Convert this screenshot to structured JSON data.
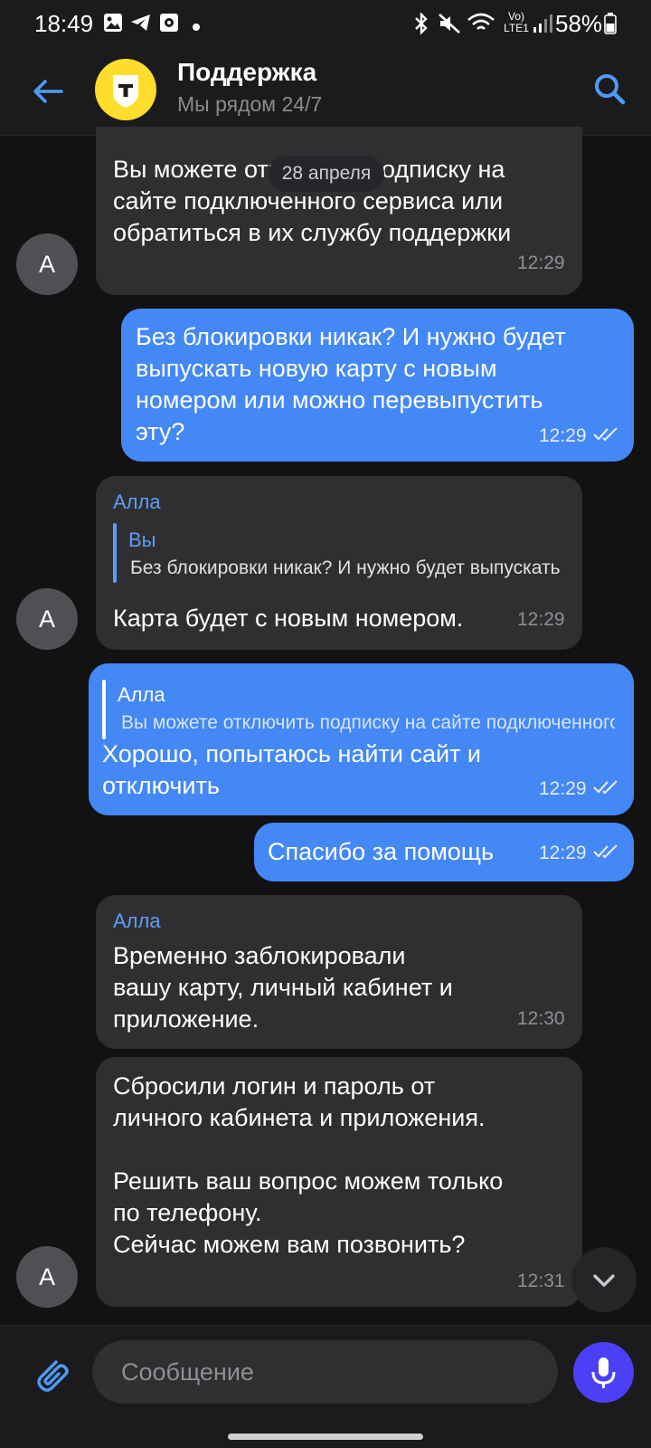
{
  "status_bar": {
    "time": "18:49",
    "battery": "58%",
    "network": "Vo) LTE1"
  },
  "header": {
    "title": "Поддержка",
    "subtitle": "Мы рядом 24/7",
    "logo_letter": "Т"
  },
  "date_separator": "28 апреля",
  "messages": [
    {
      "direction": "incoming",
      "text": "Вы можете отключить подписку на\nсайте подключенного сервиса или\nобратиться в их службу поддержки",
      "time": "12:29",
      "avatar": "А"
    },
    {
      "direction": "outgoing",
      "text": "Без блокировки никак? И нужно будет\nвыпускать новую карту с новым\nномером или можно перевыпустить\nэту?",
      "time": "12:29",
      "read": true
    },
    {
      "direction": "incoming",
      "sender": "Алла",
      "quote_author": "Вы",
      "quote_text": "Без блокировки никак? И нужно будет выпускать новую карту",
      "text": "Карта будет с новым номером.",
      "time": "12:29",
      "avatar": "А"
    },
    {
      "direction": "outgoing",
      "quote_author": "Алла",
      "quote_text": "Вы можете отключить подписку на сайте подключенного сервиса",
      "text": "Хорошо, попытаюсь найти сайт и\nотключить",
      "time": "12:29",
      "read": true
    },
    {
      "direction": "outgoing",
      "text": "Спасибо за помощь",
      "time": "12:29",
      "read": true
    },
    {
      "direction": "incoming",
      "sender": "Алла",
      "text": "Временно заблокировали\nвашу карту, личный кабинет и\nприложение.",
      "time": "12:30"
    },
    {
      "direction": "incoming",
      "text": "Сбросили логин и пароль от\nличного кабинета и приложения.\n\nРешить ваш вопрос можем только\nпо телефону.\nСейчас можем вам позвонить?",
      "time": "12:31",
      "avatar": "А"
    }
  ],
  "composer": {
    "placeholder": "Сообщение"
  },
  "colors": {
    "background": "#121213",
    "incoming_bubble": "#2f2f32",
    "outgoing_bubble": "#4488f6",
    "accent": "#4c9bf5",
    "mic_button": "#4c40f7",
    "logo_yellow": "#ffdd2d"
  },
  "icons": [
    "back-arrow-icon",
    "search-icon",
    "attach-icon",
    "microphone-icon",
    "chevron-down-icon",
    "double-check-icon"
  ]
}
